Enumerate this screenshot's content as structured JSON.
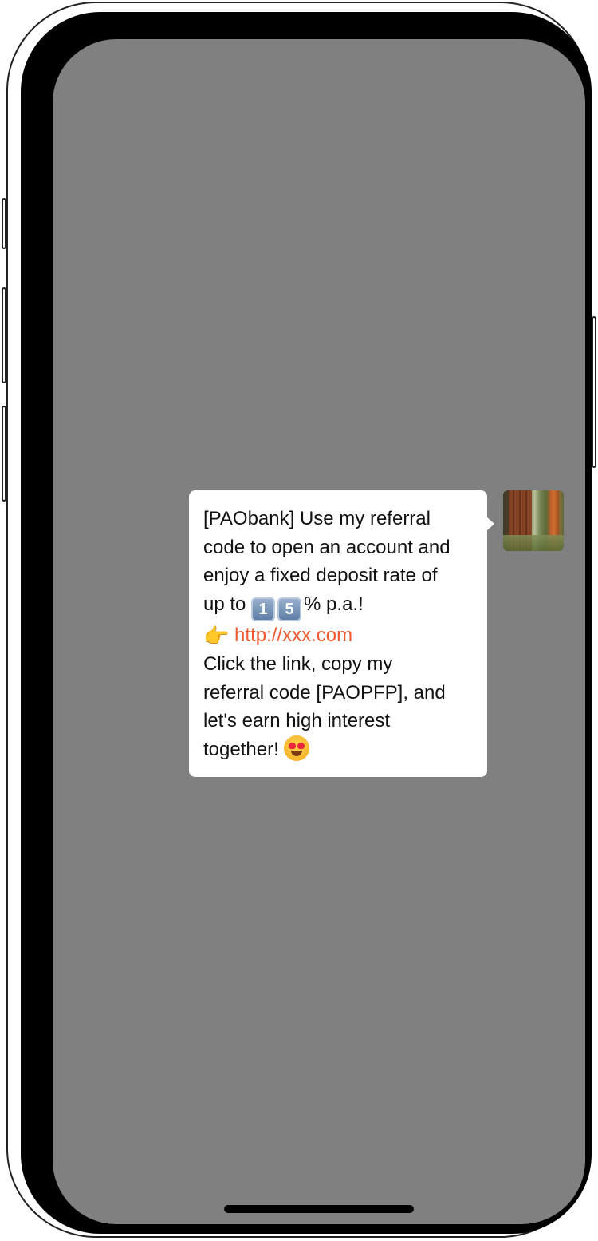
{
  "message": {
    "line1": "[PAObank] Use my referral",
    "line2": "code to open an account and",
    "line3": "enjoy a fixed deposit rate of",
    "line4_prefix": "up to ",
    "keycap1": "1",
    "keycap2": "5",
    "line4_suffix": "% p.a.!",
    "pointing_emoji": "👉",
    "link": "http://xxx.com",
    "line6": "Click the link, copy my",
    "line7": "referral code [PAOPFP], and",
    "line8": "let's earn high interest",
    "line9": "together!"
  },
  "colors": {
    "screen_background": "#808080",
    "bubble_background": "#ffffff",
    "link": "#ee5a2f"
  },
  "icons": {
    "avatar": "forest-photo-avatar",
    "emoji_end": "smiling-face-with-heart-eyes-icon",
    "emoji_pointing": "backhand-index-pointing-right-icon"
  }
}
